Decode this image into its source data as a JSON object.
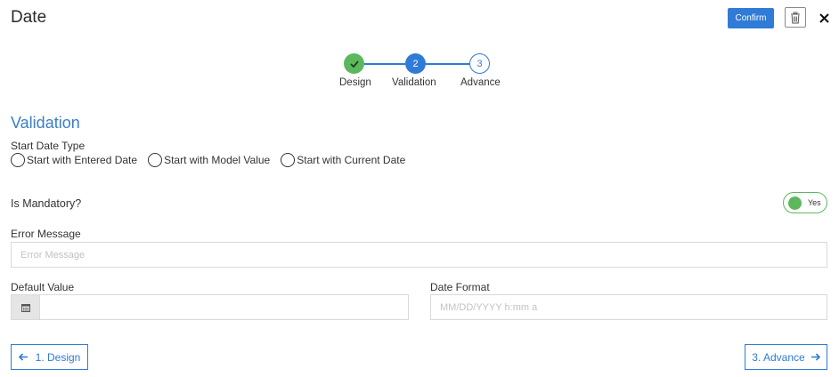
{
  "header": {
    "title": "Date",
    "confirm_label": "Confirm"
  },
  "stepper": {
    "steps": [
      {
        "number": "1",
        "label": "Design",
        "state": "completed"
      },
      {
        "number": "2",
        "label": "Validation",
        "state": "active"
      },
      {
        "number": "3",
        "label": "Advance",
        "state": "pending"
      }
    ]
  },
  "section": {
    "heading": "Validation"
  },
  "start_date_type": {
    "label": "Start Date Type",
    "options": [
      "Start with Entered Date",
      "Start with Model Value",
      "Start with Current Date"
    ]
  },
  "mandatory": {
    "label": "Is Mandatory?",
    "toggle_text": "Yes"
  },
  "error_message": {
    "label": "Error Message",
    "placeholder": "Error Message"
  },
  "default_value": {
    "label": "Default Value",
    "value": ""
  },
  "date_format": {
    "label": "Date Format",
    "placeholder": "MM/DD/YYYY h:mm a"
  },
  "nav": {
    "prev_label": "1. Design",
    "next_label": "3. Advance"
  },
  "colors": {
    "accent": "#2f7bd6",
    "success": "#5cb85c",
    "heading": "#3a7fc6"
  },
  "icons": [
    "trash-icon",
    "close-icon",
    "check-icon",
    "calendar-icon",
    "arrow-left-icon",
    "arrow-right-icon"
  ]
}
